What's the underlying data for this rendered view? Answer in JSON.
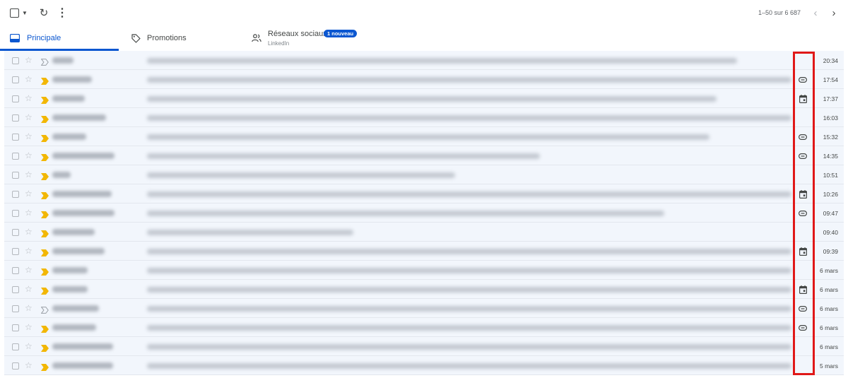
{
  "toolbar": {
    "select_icon": "checkbox-icon",
    "select_menu_icon": "caret-down-icon",
    "refresh_icon": "refresh-icon",
    "more_icon": "more-vert-icon",
    "pagination": "1–50 sur 6 687",
    "prev_icon": "chevron-left-icon",
    "next_icon": "chevron-right-icon"
  },
  "tabs": [
    {
      "label": "Principale",
      "icon": "inbox-icon",
      "active": true
    },
    {
      "label": "Promotions",
      "icon": "tag-icon",
      "active": false
    },
    {
      "label": "Réseaux sociaux",
      "icon": "people-icon",
      "active": false,
      "badge": "1 nouveau",
      "sublabel": "LinkedIn"
    }
  ],
  "emails": [
    {
      "important": false,
      "icon": "",
      "date": "20:34"
    },
    {
      "important": true,
      "icon": "attachment-icon",
      "date": "17:54"
    },
    {
      "important": true,
      "icon": "calendar-icon",
      "date": "17:37"
    },
    {
      "important": true,
      "icon": "",
      "date": "16:03"
    },
    {
      "important": true,
      "icon": "attachment-icon",
      "date": "15:32"
    },
    {
      "important": true,
      "icon": "attachment-icon",
      "date": "14:35"
    },
    {
      "important": true,
      "icon": "",
      "date": "10:51"
    },
    {
      "important": true,
      "icon": "calendar-icon",
      "date": "10:26"
    },
    {
      "important": true,
      "icon": "attachment-icon",
      "date": "09:47"
    },
    {
      "important": true,
      "icon": "",
      "date": "09:40"
    },
    {
      "important": true,
      "icon": "calendar-icon",
      "date": "09:39"
    },
    {
      "important": true,
      "icon": "",
      "date": "6 mars"
    },
    {
      "important": true,
      "icon": "calendar-icon",
      "date": "6 mars"
    },
    {
      "important": false,
      "icon": "attachment-icon",
      "date": "6 mars"
    },
    {
      "important": true,
      "icon": "attachment-icon",
      "date": "6 mars"
    },
    {
      "important": true,
      "icon": "",
      "date": "6 mars"
    },
    {
      "important": true,
      "icon": "",
      "date": "5 mars"
    }
  ],
  "colors": {
    "accent": "#0b57d0",
    "row_background": "#f2f6fc",
    "important_marker": "#f2b705",
    "highlight_outline": "#e01818"
  }
}
